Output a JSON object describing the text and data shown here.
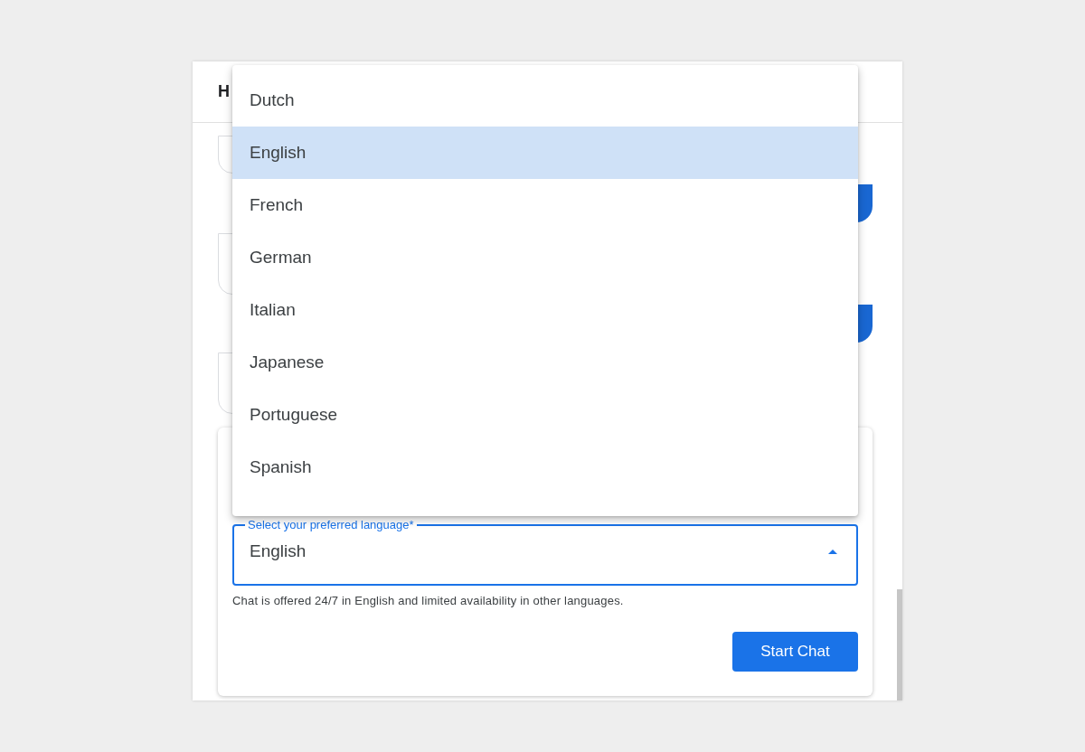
{
  "header": {
    "title": "H"
  },
  "language_menu": {
    "options": [
      {
        "label": "Dutch",
        "selected": false
      },
      {
        "label": "English",
        "selected": true
      },
      {
        "label": "French",
        "selected": false
      },
      {
        "label": "German",
        "selected": false
      },
      {
        "label": "Italian",
        "selected": false
      },
      {
        "label": "Japanese",
        "selected": false
      },
      {
        "label": "Portuguese",
        "selected": false
      },
      {
        "label": "Spanish",
        "selected": false
      }
    ]
  },
  "language_field": {
    "label": "Select your preferred language*",
    "value": "English",
    "expanded": true
  },
  "helper_text": "Chat is offered 24/7 in English and limited availability in other languages.",
  "buttons": [
    {
      "label": "Start Chat"
    }
  ]
}
